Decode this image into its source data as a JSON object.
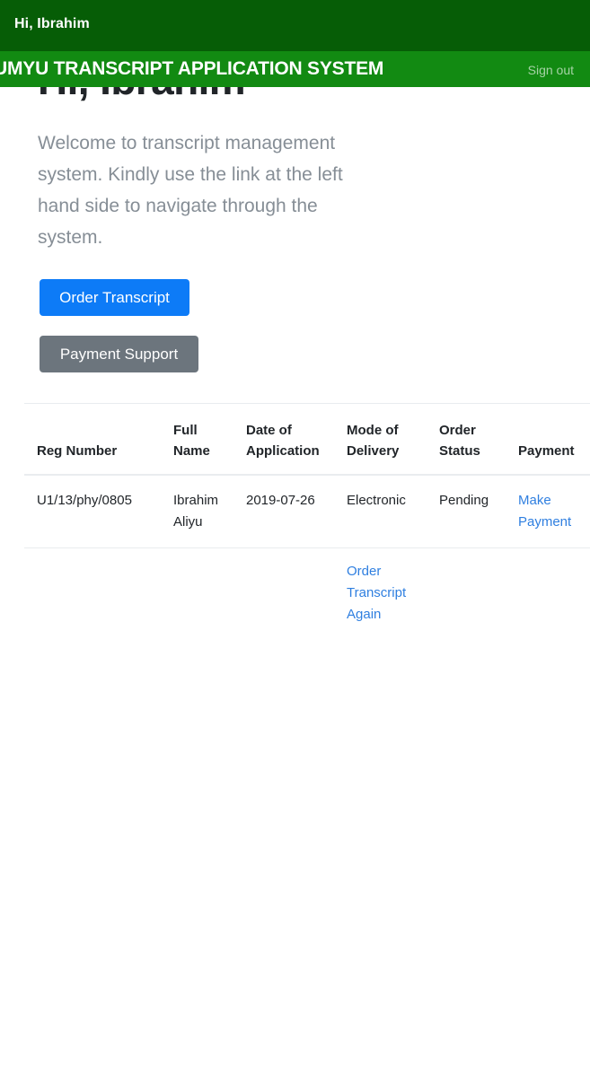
{
  "topbar": {
    "greeting": "Hi, Ibrahim"
  },
  "navbar": {
    "brand": "UMYU TRANSCRIPT APPLICATION SYSTEM",
    "signout_label": "Sign out",
    "background_color": "#128a12",
    "topbar_color": "#065d06"
  },
  "main": {
    "heading": "Hi, Ibrahim",
    "welcome_text": "Welcome to transcript management system. Kindly use the link at the left hand side to navigate through the system.",
    "buttons": {
      "order_transcript": "Order Transcript",
      "payment_support": "Payment Support",
      "order_color": "#0d7bf7",
      "support_color": "#6c757d"
    }
  },
  "table": {
    "headers": [
      "Reg Number",
      "Full Name",
      "Date of Application",
      "Mode of Delivery",
      "Order Status",
      "Payment"
    ],
    "rows": [
      {
        "reg_number": "U1/13/phy/0805",
        "full_name": "Ibrahim Aliyu",
        "date_of_application": "2019-07-26",
        "mode_of_delivery": "Electronic",
        "order_status": "Pending",
        "payment_link": "Make Payment"
      }
    ],
    "extra_row": {
      "order_again_link": "Order Transcript Again"
    },
    "link_color": "#2f7fe0"
  }
}
